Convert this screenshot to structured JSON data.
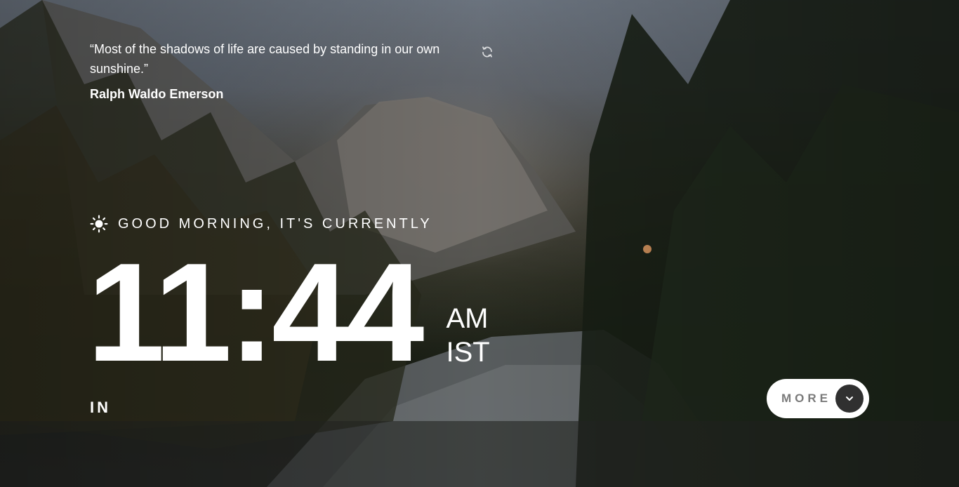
{
  "quote": {
    "text": "“Most of the shadows of life are caused by standing in our own sunshine.”",
    "author": "Ralph Waldo Emerson",
    "refresh_icon": "refresh-icon"
  },
  "greeting": {
    "icon": "sun-icon",
    "text": "GOOD MORNING, IT'S CURRENTLY"
  },
  "clock": {
    "time": "11:44",
    "meridiem": "AM",
    "timezone": "IST"
  },
  "location": "IN",
  "more_button": {
    "label": "MORE",
    "icon": "chevron-down-icon"
  }
}
